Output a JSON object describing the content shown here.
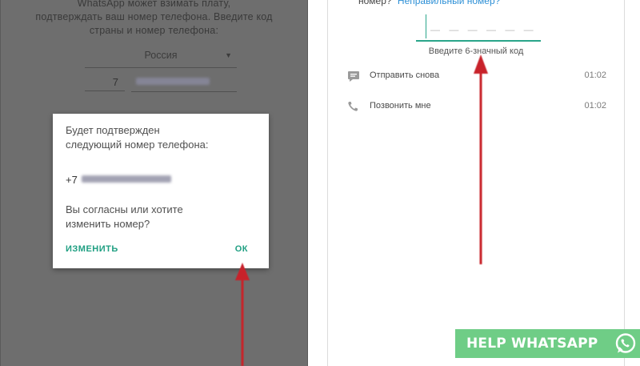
{
  "left_screen": {
    "intro_lines": [
      "WhatsApp может взимать плату,",
      "подтверждать ваш номер телефона. Введите код",
      "страны и номер телефона:"
    ],
    "country": "Россия",
    "country_code": "7",
    "dialog": {
      "message_lines": [
        "Будет подтвержден",
        "следующий номер телефона:"
      ],
      "phone_prefix": "+7",
      "question_lines": [
        "Вы согласны или хотите",
        "изменить номер?"
      ],
      "edit_button": "ИЗМЕНИТЬ",
      "ok_button": "ОК"
    }
  },
  "right_screen": {
    "top_text": "номер?",
    "wrong_number_link": "Неправильный номер?",
    "code_placeholder": "— — —  — — —",
    "code_hint": "Введите 6-значный код",
    "options": [
      {
        "label": "Отправить снова",
        "timer": "01:02",
        "icon": "sms-icon"
      },
      {
        "label": "Позвонить мне",
        "timer": "01:02",
        "icon": "phone-icon"
      }
    ]
  },
  "badge": {
    "text": "HELP WHATSAPP",
    "icon": "whatsapp-icon"
  },
  "colors": {
    "accent": "#1f9f82",
    "arrow": "#c8202a",
    "badge_bg": "#6fcd86",
    "link": "#2c8fd6",
    "dim_overlay": "#6e6e6e"
  }
}
